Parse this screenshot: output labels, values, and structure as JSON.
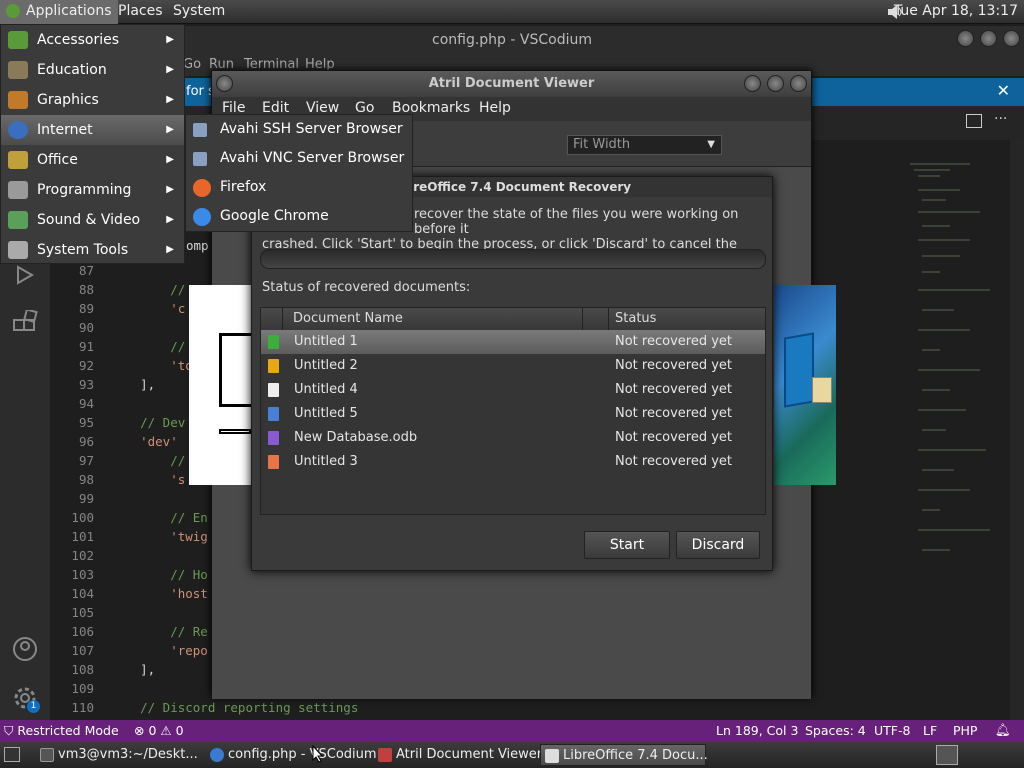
{
  "top_panel": {
    "menus": [
      "Applications",
      "Places",
      "System"
    ],
    "clock": "Tue Apr 18, 13:17"
  },
  "vscodium": {
    "title": "config.php - VSCodium",
    "menus": [
      "Go",
      "Run",
      "Terminal",
      "Help"
    ],
    "banner_text": "for sa",
    "lines": [
      {
        "n": "87",
        "code": ""
      },
      {
        "n": "88",
        "code": "        //"
      },
      {
        "n": "89",
        "code": "        'c"
      },
      {
        "n": "90",
        "code": ""
      },
      {
        "n": "91",
        "code": "        //"
      },
      {
        "n": "92",
        "code": "        'to"
      },
      {
        "n": "93",
        "code": "    ],"
      },
      {
        "n": "94",
        "code": ""
      },
      {
        "n": "95",
        "code": "    // Dev"
      },
      {
        "n": "96",
        "code": "    'dev'"
      },
      {
        "n": "97",
        "code": "        //"
      },
      {
        "n": "98",
        "code": "        's"
      },
      {
        "n": "99",
        "code": ""
      },
      {
        "n": "100",
        "code": "        // En"
      },
      {
        "n": "101",
        "code": "        'twig"
      },
      {
        "n": "102",
        "code": ""
      },
      {
        "n": "103",
        "code": "        // Ho"
      },
      {
        "n": "104",
        "code": "        'host"
      },
      {
        "n": "105",
        "code": ""
      },
      {
        "n": "106",
        "code": "        // Re"
      },
      {
        "n": "107",
        "code": "        'repo"
      },
      {
        "n": "108",
        "code": "    ],"
      },
      {
        "n": "109",
        "code": ""
      },
      {
        "n": "110",
        "code": "    // Discord reporting settings"
      }
    ],
    "partial_above": [
      "co",
      "omp"
    ],
    "status_bar": {
      "restricted": "Restricted Mode",
      "errors": "0",
      "warnings": "0",
      "position": "Ln 189, Col 3",
      "spaces": "Spaces: 4",
      "encoding": "UTF-8",
      "eol": "LF",
      "language": "PHP"
    },
    "settings_badge": "1"
  },
  "atril": {
    "title": "Atril Document Viewer",
    "menus": [
      "File",
      "Edit",
      "View",
      "Go",
      "Bookmarks",
      "Help"
    ],
    "zoom": "Fit Width"
  },
  "recovery": {
    "title": "LibreOffice 7.4 Document Recovery",
    "desc_line1": "recover the state of the files you were working on before it",
    "desc_line2": "crashed. Click 'Start' to begin the process, or click 'Discard' to cancel the recovery.",
    "status_label": "Status of recovered documents:",
    "columns": [
      "Document Name",
      "Status"
    ],
    "rows": [
      {
        "name": "Untitled 1",
        "status": "Not recovered yet",
        "color": "#3cae3c"
      },
      {
        "name": "Untitled 2",
        "status": "Not recovered yet",
        "color": "#e6a817"
      },
      {
        "name": "Untitled 4",
        "status": "Not recovered yet",
        "color": "#eeeeee"
      },
      {
        "name": "Untitled 5",
        "status": "Not recovered yet",
        "color": "#4a7fd6"
      },
      {
        "name": "New Database.odb",
        "status": "Not recovered yet",
        "color": "#8a5bd0"
      },
      {
        "name": "Untitled 3",
        "status": "Not recovered yet",
        "color": "#e8744a"
      }
    ],
    "start": "Start",
    "discard": "Discard"
  },
  "apps_menu": {
    "items": [
      {
        "label": "Accessories",
        "icon": "accessories-icon",
        "color": "#5a9a3a"
      },
      {
        "label": "Education",
        "icon": "education-icon",
        "color": "#8a7a5a"
      },
      {
        "label": "Graphics",
        "icon": "graphics-icon",
        "color": "#c07a2a"
      },
      {
        "label": "Internet",
        "icon": "internet-icon",
        "color": "#3a6fc0"
      },
      {
        "label": "Office",
        "icon": "office-icon",
        "color": "#c0a03a"
      },
      {
        "label": "Programming",
        "icon": "programming-icon",
        "color": "#9a9a9a"
      },
      {
        "label": "Sound & Video",
        "icon": "sound-video-icon",
        "color": "#5aa05a"
      },
      {
        "label": "System Tools",
        "icon": "system-tools-icon",
        "color": "#aaaaaa"
      }
    ],
    "internet_submenu": [
      {
        "label": "Avahi SSH Server Browser",
        "icon": "avahi-ssh-icon",
        "color": "#8aa0c0"
      },
      {
        "label": "Avahi VNC Server Browser",
        "icon": "avahi-vnc-icon",
        "color": "#8aa0c0"
      },
      {
        "label": "Firefox",
        "icon": "firefox-icon",
        "color": "#e8662a"
      },
      {
        "label": "Google Chrome",
        "icon": "chrome-icon",
        "color": "#3a8ae8"
      }
    ]
  },
  "taskbar": {
    "tasks": [
      {
        "label": "vm3@vm3:~/Deskt...",
        "color": "#555"
      },
      {
        "label": "config.php - VSCodium",
        "color": "#3a7ad0"
      },
      {
        "label": "Atril Document Viewer",
        "color": "#c04040"
      },
      {
        "label": "LibreOffice 7.4 Docu...",
        "color": "#ddd"
      }
    ]
  }
}
